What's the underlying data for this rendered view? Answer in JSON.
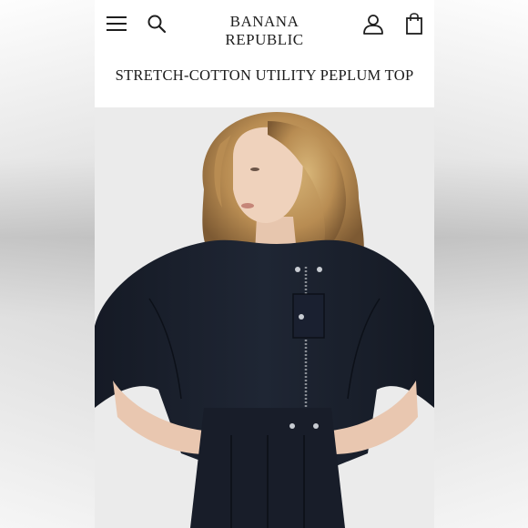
{
  "header": {
    "brand": "BANANA REPUBLIC",
    "menu_icon": "hamburger-menu-icon",
    "search_icon": "search-icon",
    "account_icon": "account-icon",
    "bag_icon": "shopping-bag-icon"
  },
  "product": {
    "title": "STRETCH-COTTON UTILITY PEPLUM TOP"
  },
  "colors": {
    "page_background": "#ffffff",
    "text": "#1a1a1a",
    "garment_navy": "#1c2230"
  }
}
